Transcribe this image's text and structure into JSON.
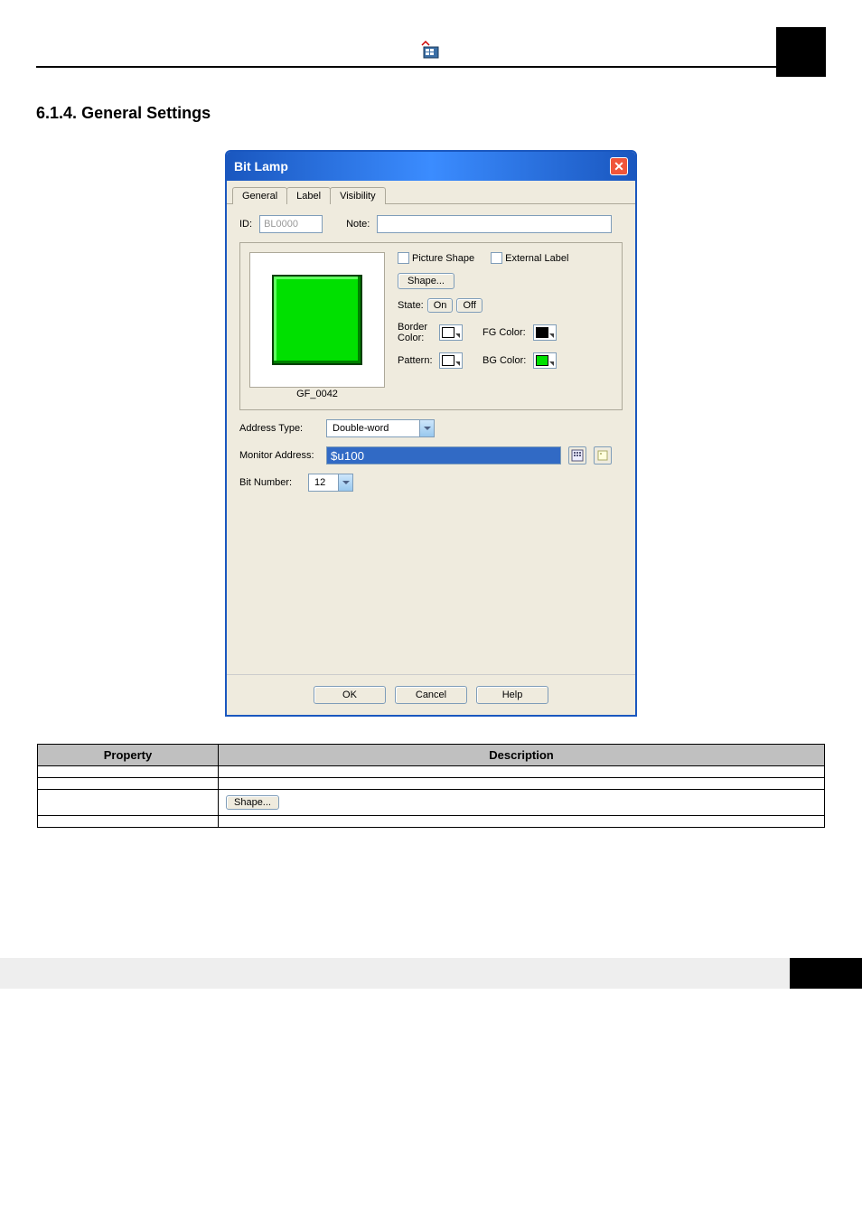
{
  "header": {
    "chapter_line": "",
    "section_number": "6.1.4.",
    "section_title": "General Settings"
  },
  "dialog": {
    "title": "Bit Lamp",
    "tabs": {
      "general": "General",
      "label": "Label",
      "visibility": "Visibility"
    },
    "id_label": "ID:",
    "id_value": "BL0000",
    "note_label": "Note:",
    "note_value": "",
    "preview_name": "GF_0042",
    "picture_shape": "Picture Shape",
    "external_label": "External Label",
    "shape_btn": "Shape...",
    "state_label": "State:",
    "state_on": "On",
    "state_off": "Off",
    "border_color_label": "Border Color:",
    "fg_color_label": "FG Color:",
    "pattern_label": "Pattern:",
    "bg_color_label": "BG Color:",
    "colors": {
      "border": "#ffffff",
      "fg": "#000000",
      "pattern": "#ffffff",
      "bg": "#00e000"
    },
    "addr_type_label": "Address Type:",
    "addr_type_value": "Double-word",
    "monitor_label": "Monitor Address:",
    "monitor_value": "$u100",
    "bitnum_label": "Bit Number:",
    "bitnum_value": "12",
    "ok": "OK",
    "cancel": "Cancel",
    "help": "Help"
  },
  "intro_text": "",
  "table": {
    "headers": {
      "property": "Property",
      "description": "Description"
    },
    "rows": [
      {
        "prop": "",
        "desc": ""
      },
      {
        "prop": "",
        "desc": ""
      },
      {
        "prop": "",
        "desc_pre": "",
        "desc_link": "",
        "desc_mid": "",
        "shape_btn": "Shape...",
        "desc_post": ""
      },
      {
        "prop": "",
        "desc": ""
      }
    ],
    "continued": ""
  },
  "footer": {
    "page": ""
  }
}
